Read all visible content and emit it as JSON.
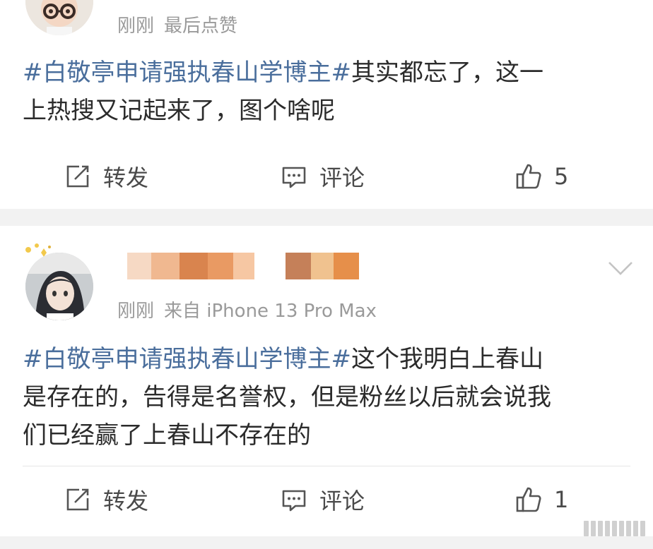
{
  "posts": [
    {
      "meta_time": "刚刚",
      "meta_extra": "最后点赞",
      "topic": "#白敬亭申请强执春山学博主#",
      "text_line1": "其实都忘了，这一",
      "text_line2": "上热搜又记起来了，图个啥呢",
      "actions": {
        "repost": "转发",
        "comment": "评论",
        "like": "5"
      }
    },
    {
      "meta_time": "刚刚",
      "meta_extra": "来自 iPhone 13 Pro Max",
      "topic": "#白敬亭申请强执春山学博主#",
      "text_line1": "这个我明白上春山",
      "text_line2": "是存在的，告得是名誉权，但是粉丝以后就会说我",
      "text_line3": "们已经赢了上春山不存在的",
      "actions": {
        "repost": "转发",
        "comment": "评论",
        "like": "1"
      }
    }
  ],
  "icons": {
    "repost": "edit-share-icon",
    "comment": "comment-bubble-icon",
    "like": "thumbs-up-icon",
    "more": "chevron-down-icon"
  },
  "colors": {
    "topic": "#4a6e9c",
    "meta": "#9a9a9a",
    "separator": "#f2f2f2"
  }
}
